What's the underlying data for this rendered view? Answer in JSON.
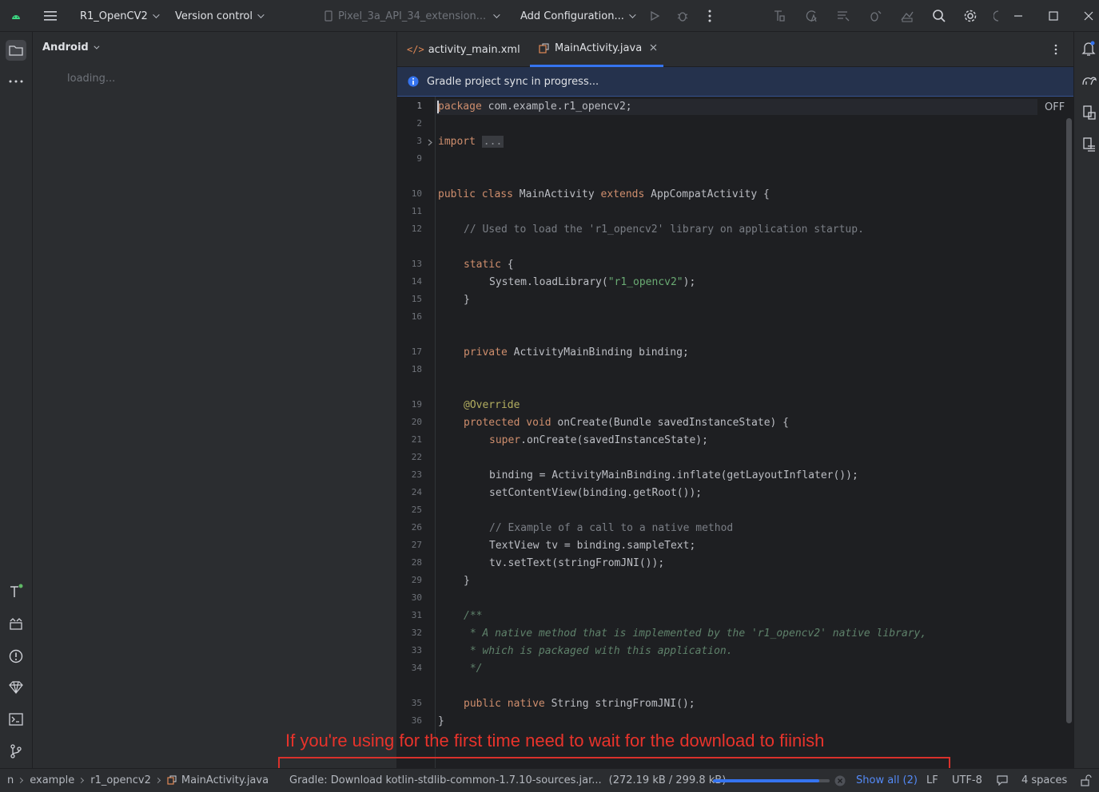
{
  "titlebar": {
    "project_name": "R1_OpenCV2",
    "version_control": "Version control",
    "device": "Pixel_3a_API_34_extension...",
    "run_config": "Add Configuration..."
  },
  "project_panel": {
    "view_mode": "Android",
    "loading_text": "loading..."
  },
  "editor": {
    "tabs": [
      {
        "label": "activity_main.xml",
        "active": false
      },
      {
        "label": "MainActivity.java",
        "active": true
      }
    ],
    "banner_text": "Gradle project sync in progress...",
    "inspection_state": "OFF",
    "line_numbers": [
      "1",
      "2",
      "3",
      "9",
      "10",
      "11",
      "12",
      "13",
      "14",
      "15",
      "16",
      "17",
      "18",
      "19",
      "20",
      "21",
      "22",
      "23",
      "24",
      "25",
      "26",
      "27",
      "28",
      "29",
      "30",
      "31",
      "32",
      "33",
      "34",
      "35",
      "36"
    ],
    "code": {
      "l1_kw": "package",
      "l1_rest": " com.example.r1_opencv2;",
      "l3_kw": "import",
      "l3_fold": "...",
      "l10_kw1": "public",
      "l10_kw2": "class",
      "l10_name": " MainActivity ",
      "l10_kw3": "extends",
      "l10_rest": " AppCompatActivity {",
      "l12_comment": "// Used to load the 'r1_opencv2' library on application startup.",
      "l13_kw": "static",
      "l13_rest": " {",
      "l14_pre": "System.loadLibrary(",
      "l14_str": "\"r1_opencv2\"",
      "l14_post": ");",
      "l15": "}",
      "l17_kw": "private",
      "l17_rest": " ActivityMainBinding binding;",
      "l19_ann": "@Override",
      "l20_kw1": "protected",
      "l20_kw2": "void",
      "l20_rest": " onCreate(Bundle savedInstanceState) {",
      "l21_kw": "super",
      "l21_rest": ".onCreate(savedInstanceState);",
      "l23": "binding = ActivityMainBinding.inflate(getLayoutInflater());",
      "l24": "setContentView(binding.getRoot());",
      "l26_comment": "// Example of a call to a native method",
      "l27": "TextView tv = binding.sampleText;",
      "l28": "tv.setText(stringFromJNI());",
      "l29": "}",
      "l31_doc": "/**",
      "l32_doc": " * A native method that is implemented by the 'r1_opencv2' native library,",
      "l33_doc": " * which is packaged with this application.",
      "l34_doc": " */",
      "l35_kw1": "public",
      "l35_kw2": "native",
      "l35_rest": " String stringFromJNI();",
      "l36": "}"
    }
  },
  "statusbar": {
    "breadcrumb_first": "n",
    "breadcrumb": [
      "example",
      "r1_opencv2",
      "MainActivity.java"
    ],
    "task_text": "Gradle: Download kotlin-stdlib-common-1.7.10-sources.jar...",
    "task_progress_text": "(272.19 kB / 299.8 kB)",
    "task_progress": 0.908,
    "show_all": "Show all (2)",
    "line_separator": "LF",
    "encoding": "UTF-8",
    "indent": "4 spaces"
  },
  "annotation": {
    "text": "If you're using for the first time need to wait for the download to fiinish",
    "color": "#e8332b"
  },
  "colors": {
    "accent": "#3574f0",
    "keyword": "#cf8e6d",
    "string": "#6aab73",
    "comment": "#7a7e85",
    "doc_comment": "#5f826b",
    "annotation_code": "#b3ae60"
  }
}
